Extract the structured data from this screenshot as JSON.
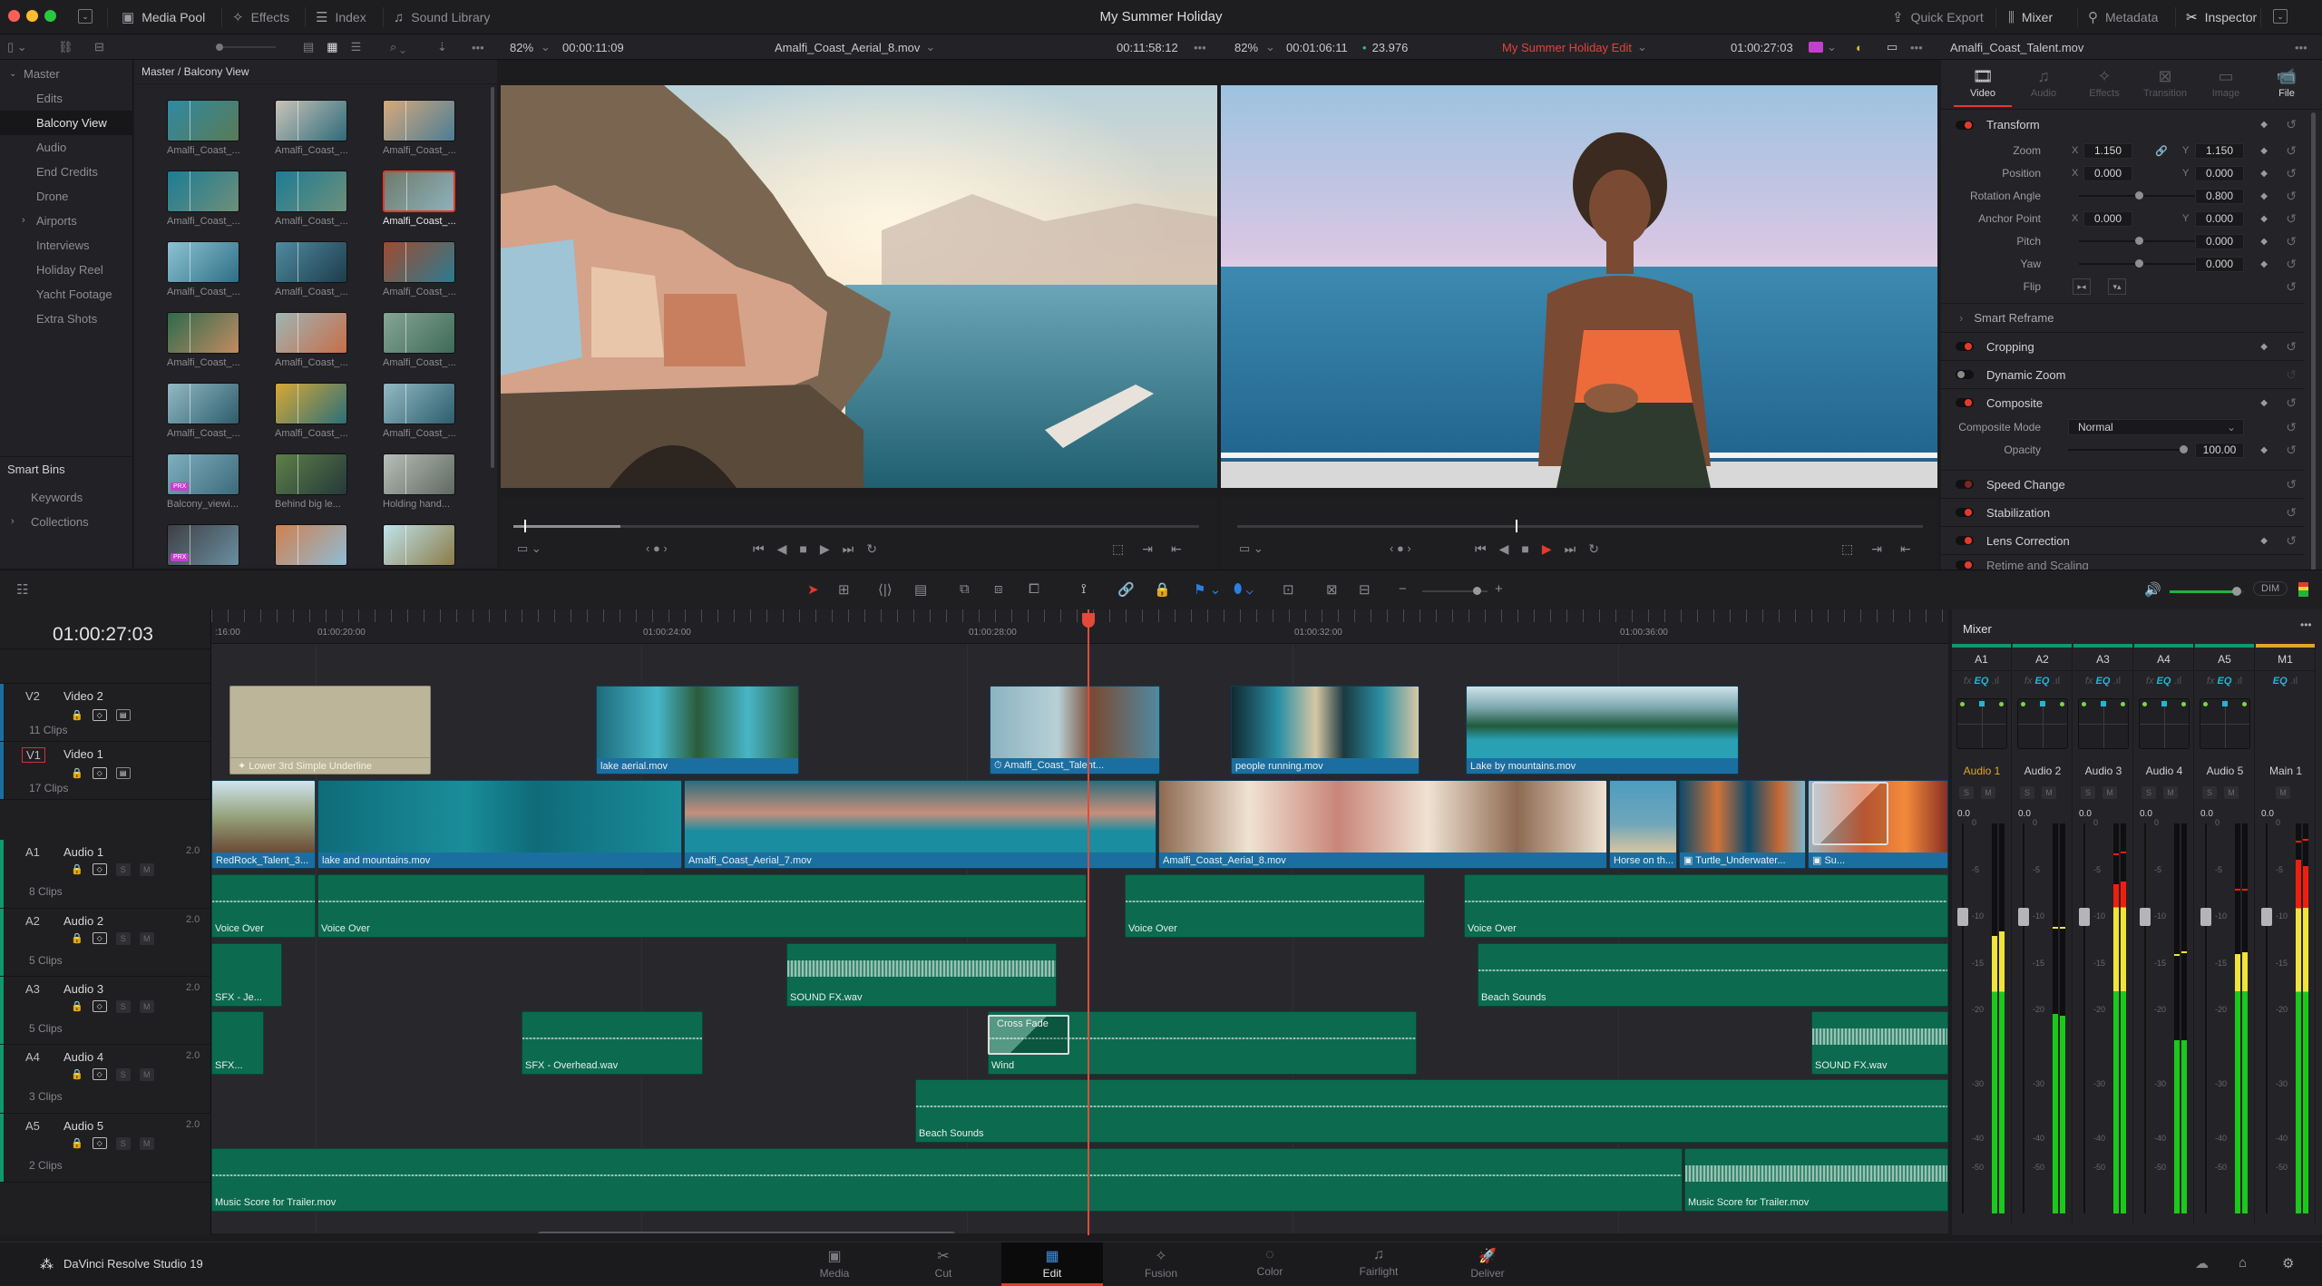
{
  "app": {
    "title": "My Summer Holiday",
    "product": "DaVinci Resolve Studio 19"
  },
  "titlebar": {
    "left_tools": [
      {
        "label": "Media Pool",
        "icon": "media-pool-icon",
        "active": true
      },
      {
        "label": "Effects",
        "icon": "effects-wand-icon",
        "active": false
      },
      {
        "label": "Index",
        "icon": "index-list-icon",
        "active": false
      },
      {
        "label": "Sound Library",
        "icon": "sound-library-icon",
        "active": false
      }
    ],
    "right_tools": [
      {
        "label": "Quick Export",
        "icon": "export-icon",
        "active": false
      },
      {
        "label": "Mixer",
        "icon": "mixer-icon",
        "active": true
      },
      {
        "label": "Metadata",
        "icon": "metadata-icon",
        "active": false
      },
      {
        "label": "Inspector",
        "icon": "inspector-icon",
        "active": true
      }
    ]
  },
  "source_viewer": {
    "zoom": "82%",
    "timecode_in": "00:00:11:09",
    "clip_name": "Amalfi_Coast_Aerial_8.mov",
    "duration": "00:11:58:12"
  },
  "timeline_viewer": {
    "zoom": "82%",
    "timecode_in": "00:01:06:11",
    "fps": "23.976",
    "timeline_name": "My Summer Holiday Edit",
    "timecode": "01:00:27:03"
  },
  "inspector_clip": "Amalfi_Coast_Talent.mov",
  "bins": {
    "root": "Master",
    "items": [
      "Edits",
      "Balcony View",
      "Audio",
      "End Credits",
      "Drone",
      "Airports",
      "Interviews",
      "Holiday Reel",
      "Yacht Footage",
      "Extra Shots"
    ],
    "selected": "Balcony View",
    "smart_bins_title": "Smart Bins",
    "smart_bins": [
      "Keywords",
      "Collections"
    ]
  },
  "media_pool": {
    "path": "Master / Balcony View",
    "clips": [
      {
        "name": "Amalfi_Coast_...",
        "colors": [
          "#2f8aa3",
          "#5a7a55"
        ]
      },
      {
        "name": "Amalfi_Coast_...",
        "colors": [
          "#c9c3b8",
          "#2e6b7a"
        ]
      },
      {
        "name": "Amalfi_Coast_...",
        "colors": [
          "#d7a97c",
          "#4b7d95"
        ]
      },
      {
        "name": "Amalfi_Coast_...",
        "colors": [
          "#1c7c94",
          "#6f8f7a"
        ]
      },
      {
        "name": "Amalfi_Coast_...",
        "colors": [
          "#1c7c94",
          "#6f8f7a"
        ]
      },
      {
        "name": "Amalfi_Coast_...",
        "colors": [
          "#6e7b6c",
          "#8fb1bb"
        ],
        "selected": true
      },
      {
        "name": "Amalfi_Coast_...",
        "colors": [
          "#8dc3d2",
          "#2d6f87"
        ]
      },
      {
        "name": "Amalfi_Coast_...",
        "colors": [
          "#4f8aa0",
          "#1d3d4b"
        ]
      },
      {
        "name": "Amalfi_Coast_...",
        "colors": [
          "#a04a30",
          "#2b7c8f"
        ]
      },
      {
        "name": "Amalfi_Coast_...",
        "colors": [
          "#2e6a4c",
          "#c28b62"
        ]
      },
      {
        "name": "Amalfi_Coast_...",
        "colors": [
          "#9fb5b3",
          "#c76e4a"
        ]
      },
      {
        "name": "Amalfi_Coast_...",
        "colors": [
          "#86a597",
          "#3e6a58"
        ]
      },
      {
        "name": "Amalfi_Coast_...",
        "colors": [
          "#93b9c4",
          "#2d5d6d"
        ]
      },
      {
        "name": "Amalfi_Coast_...",
        "colors": [
          "#d7a834",
          "#2b6f79"
        ]
      },
      {
        "name": "Amalfi_Coast_...",
        "colors": [
          "#93b9c4",
          "#2d5d6d"
        ]
      },
      {
        "name": "Balcony_viewi...",
        "colors": [
          "#7fb0c0",
          "#3c6a7b"
        ],
        "proxy": "PRX"
      },
      {
        "name": "Behind big le...",
        "colors": [
          "#5c8048",
          "#25393a"
        ]
      },
      {
        "name": "Holding hand...",
        "colors": [
          "#b9bdb8",
          "#5d6a61"
        ]
      },
      {
        "name": "",
        "colors": [
          "#3f3f45",
          "#6a8fa0"
        ],
        "proxy": "PRX"
      },
      {
        "name": "",
        "colors": [
          "#d0804f",
          "#8fbcd6"
        ]
      },
      {
        "name": "",
        "colors": [
          "#bfe3ea",
          "#8a7b48"
        ]
      }
    ]
  },
  "transport": {
    "buttons": [
      "jump-start",
      "step-back",
      "stop",
      "play",
      "jump-end",
      "loop"
    ]
  },
  "inspector": {
    "tabs": [
      {
        "label": "Video",
        "icon": "film-icon",
        "active": true
      },
      {
        "label": "Audio",
        "icon": "music-icon",
        "active": false
      },
      {
        "label": "Effects",
        "icon": "wand-icon",
        "active": false
      },
      {
        "label": "Transition",
        "icon": "transition-icon",
        "active": false
      },
      {
        "label": "Image",
        "icon": "image-icon",
        "active": false
      },
      {
        "label": "File",
        "icon": "camera-icon",
        "active": true
      }
    ],
    "transform": {
      "title": "Transform",
      "zoom": {
        "label": "Zoom",
        "x": "1.150",
        "y": "1.150"
      },
      "position": {
        "label": "Position",
        "x": "0.000",
        "y": "0.000"
      },
      "rotation": {
        "label": "Rotation Angle",
        "value": "0.800",
        "slider": 0.5
      },
      "anchor": {
        "label": "Anchor Point",
        "x": "0.000",
        "y": "0.000"
      },
      "pitch": {
        "label": "Pitch",
        "value": "0.000",
        "slider": 0.5
      },
      "yaw": {
        "label": "Yaw",
        "value": "0.000",
        "slider": 0.5
      },
      "flip": {
        "label": "Flip"
      }
    },
    "smart_reframe": "Smart Reframe",
    "cropping": "Cropping",
    "dynamic_zoom": "Dynamic Zoom",
    "composite": {
      "title": "Composite",
      "mode_label": "Composite Mode",
      "mode": "Normal",
      "opacity_label": "Opacity",
      "opacity": "100.00",
      "opacity_fraction": 1.0
    },
    "speed_change": "Speed Change",
    "stabilization": "Stabilization",
    "lens_correction": "Lens Correction",
    "retime": "Retime and Scaling"
  },
  "timeline": {
    "timecode": "01:00:27:03",
    "ruler_ticks": [
      ":16:00",
      "01:00:20:00",
      "01:00:24:00",
      "01:00:28:00",
      "01:00:32:00",
      "01:00:36:00"
    ],
    "tracks": [
      {
        "id": "V2",
        "name": "Video 2",
        "clips_count": "11 Clips",
        "type": "video"
      },
      {
        "id": "V1",
        "name": "Video 1",
        "clips_count": "17 Clips",
        "type": "video"
      },
      {
        "id": "A1",
        "name": "Audio 1",
        "channels": "2.0",
        "clips_count": "8 Clips",
        "type": "audio"
      },
      {
        "id": "A2",
        "name": "Audio 2",
        "channels": "2.0",
        "clips_count": "5 Clips",
        "type": "audio"
      },
      {
        "id": "A3",
        "name": "Audio 3",
        "channels": "2.0",
        "clips_count": "5 Clips",
        "type": "audio"
      },
      {
        "id": "A4",
        "name": "Audio 4",
        "channels": "2.0",
        "clips_count": "3 Clips",
        "type": "audio"
      },
      {
        "id": "A5",
        "name": "Audio 5",
        "channels": "2.0",
        "clips_count": "2 Clips",
        "type": "audio"
      }
    ],
    "clips": {
      "v2": [
        "Lower 3rd Simple Underline",
        "lake aerial.mov",
        "Amalfi_Coast_Talent...",
        "people running.mov",
        "Lake by mountains.mov"
      ],
      "v1": [
        "RedRock_Talent_3...",
        "lake and mountains.mov",
        "Amalfi_Coast_Aerial_7.mov",
        "Amalfi_Coast_Aerial_8.mov",
        "Horse on th...",
        "Turtle_Underwater...",
        "Su..."
      ],
      "a1": [
        "Voice Over",
        "Voice Over",
        "Voice Over",
        "Voice Over"
      ],
      "a2": [
        "SFX - Je...",
        "SOUND FX.wav",
        "Beach Sounds"
      ],
      "a3": [
        "SFX...",
        "SFX - Overhead.wav",
        "Wind",
        "SOUND FX.wav"
      ],
      "a3_transition": "Cross Fade",
      "a4": [
        "Beach Sounds"
      ],
      "a5": [
        "Music Score for Trailer.mov",
        "Music Score for Trailer.mov"
      ]
    }
  },
  "monitor": {
    "dim_label": "DIM",
    "volume": 0.9
  },
  "mixer": {
    "title": "Mixer",
    "channels": [
      {
        "id": "A1",
        "name": "Audio 1",
        "db": "0.0",
        "active": true,
        "level_db": [
          -12,
          -11.5
        ],
        "peak_db": [
          -12,
          -11.5
        ]
      },
      {
        "id": "A2",
        "name": "Audio 2",
        "db": "0.0",
        "active": false,
        "level_db": [
          -20.5,
          -20.8
        ],
        "peak_db": [
          -11,
          -11
        ]
      },
      {
        "id": "A3",
        "name": "Audio 3",
        "db": "0.0",
        "active": false,
        "level_db": [
          -6.5,
          -6.2
        ],
        "peak_db": [
          -3.2,
          -3
        ]
      },
      {
        "id": "A4",
        "name": "Audio 4",
        "db": "0.0",
        "active": false,
        "level_db": [
          -24,
          -24
        ],
        "peak_db": [
          -14,
          -13.7
        ]
      },
      {
        "id": "A5",
        "name": "Audio 5",
        "db": "0.0",
        "active": false,
        "level_db": [
          -14,
          -13.8
        ],
        "peak_db": [
          -7,
          -7
        ]
      },
      {
        "id": "M1",
        "name": "Main 1",
        "db": "0.0",
        "active": false,
        "level_db": [
          -3.8,
          -4.5
        ],
        "peak_db": [
          -1.8,
          -1.6
        ]
      }
    ],
    "scale": [
      "0",
      "-5",
      "-10",
      "-15",
      "-20",
      "-30",
      "-40",
      "-50"
    ]
  },
  "pages": [
    {
      "label": "Media",
      "icon": "media-page-icon"
    },
    {
      "label": "Cut",
      "icon": "cut-page-icon"
    },
    {
      "label": "Edit",
      "icon": "edit-page-icon",
      "active": true
    },
    {
      "label": "Fusion",
      "icon": "fusion-page-icon"
    },
    {
      "label": "Color",
      "icon": "color-page-icon"
    },
    {
      "label": "Fairlight",
      "icon": "fairlight-page-icon"
    },
    {
      "label": "Deliver",
      "icon": "deliver-page-icon"
    }
  ]
}
